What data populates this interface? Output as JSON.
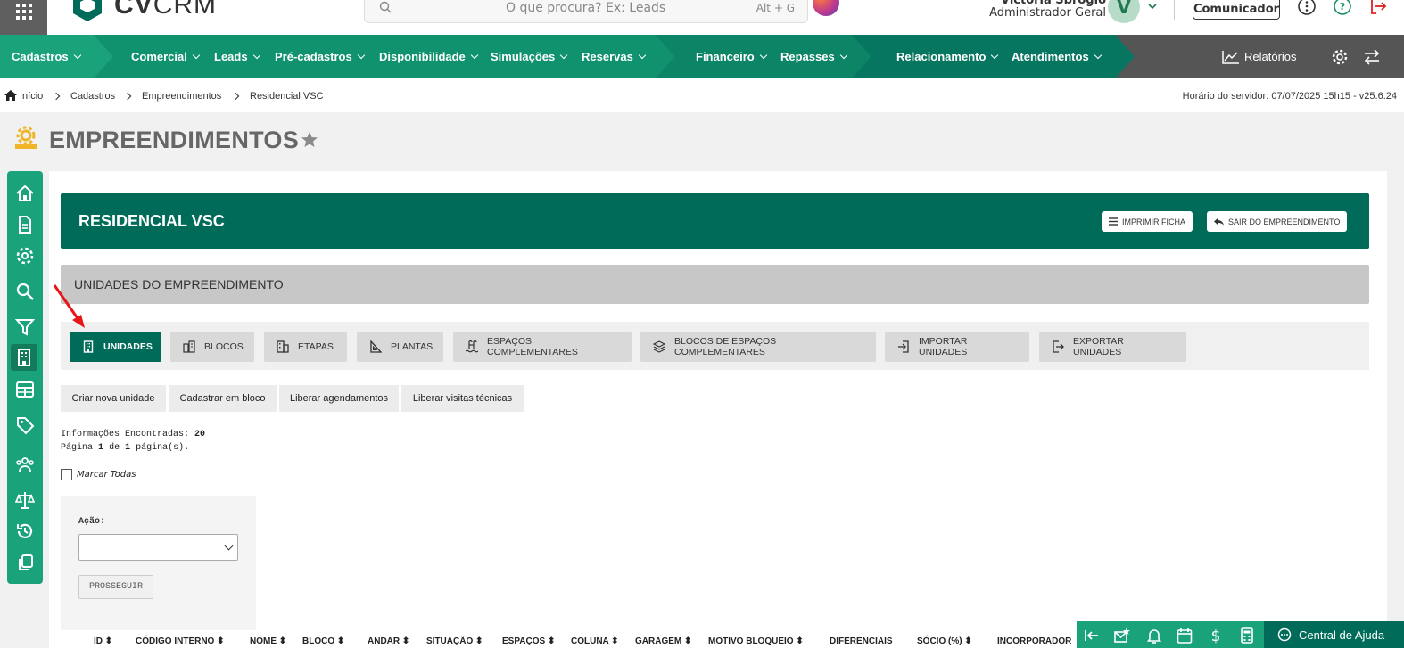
{
  "header": {
    "logo_text_bold": "CV",
    "logo_text_light": "CRM",
    "search_placeholder": "O que procura? Ex: Leads",
    "search_shortcut": "Alt + G",
    "user_name": "Victoria Sbrogio",
    "user_role": "Administrador Geral",
    "avatar_letter": "V",
    "communicator_label": "Comunicador"
  },
  "nav": {
    "groups": [
      {
        "color": "#1aa37b",
        "items": [
          "Cadastros"
        ]
      },
      {
        "color": "#10926f",
        "items": [
          "Comercial",
          "Leads",
          "Pré-cadastros",
          "Disponibilidade",
          "Simulações",
          "Reservas"
        ]
      },
      {
        "color": "#0c8466",
        "items": [
          "Financeiro",
          "Repasses"
        ]
      },
      {
        "color": "#077660",
        "items": [
          "Relacionamento",
          "Atendimentos"
        ]
      }
    ],
    "reports_label": "Relatórios"
  },
  "breadcrumb": {
    "items": [
      "Início",
      "Cadastros",
      "Empreendimentos",
      "Residencial VSC"
    ],
    "server_time": "Horário do servidor: 07/07/2025 15h15 - v25.6.24"
  },
  "page": {
    "title": "EMPREENDIMENTOS"
  },
  "empreendimento": {
    "name": "RESIDENCIAL VSC",
    "print_label": "IMPRIMIR FICHA",
    "exit_label": "SAIR DO EMPREENDIMENTO"
  },
  "section": {
    "title": "UNIDADES DO EMPREENDIMENTO"
  },
  "tabs": [
    {
      "label": "UNIDADES",
      "icon": "building-icon",
      "active": true
    },
    {
      "label": "BLOCOS",
      "icon": "blocks-icon",
      "active": false
    },
    {
      "label": "ETAPAS",
      "icon": "stages-icon",
      "active": false
    },
    {
      "label": "PLANTAS",
      "icon": "blueprint-icon",
      "active": false
    },
    {
      "label": "ESPAÇOS COMPLEMENTARES",
      "icon": "pool-icon",
      "active": false
    },
    {
      "label": "BLOCOS DE ESPAÇOS COMPLEMENTARES",
      "icon": "layers-icon",
      "active": false
    },
    {
      "label": "IMPORTAR UNIDADES",
      "icon": "import-icon",
      "active": false
    },
    {
      "label": "EXPORTAR UNIDADES",
      "icon": "export-icon",
      "active": false
    }
  ],
  "actions": [
    "Criar nova unidade",
    "Cadastrar em bloco",
    "Liberar agendamentos",
    "Liberar visitas técnicas"
  ],
  "results": {
    "found_label": "Informações Encontradas:",
    "found_count": "20",
    "page_prefix": "Página",
    "page_current": "1",
    "page_of": "de",
    "page_total": "1",
    "page_suffix": "página(s)."
  },
  "select_all_label": "Marcar Todas",
  "bulk_action": {
    "label": "Ação:",
    "selected": "",
    "proceed_label": "PROSSEGUIR"
  },
  "table": {
    "columns": [
      "ID",
      "CÓDIGO INTERNO",
      "NOME",
      "BLOCO",
      "ANDAR",
      "SITUAÇÃO",
      "ESPAÇOS",
      "COLUNA",
      "GARAGEM",
      "MOTIVO BLOQUEIO",
      "DIFERENCIAIS",
      "SÓCIO (%)",
      "INCORPORADOR"
    ]
  },
  "footer": {
    "help_label": "Central de Ajuda"
  },
  "colors": {
    "brand_dark": "#006b59",
    "brand": "#1aa37b",
    "annotation_arrow": "#e8151b"
  }
}
